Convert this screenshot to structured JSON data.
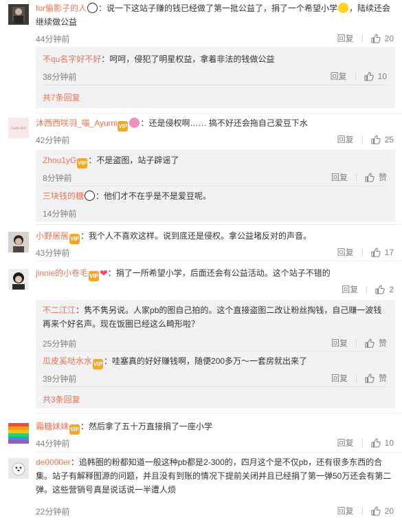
{
  "actions": {
    "reply": "回复",
    "like": "赞"
  },
  "comments": [
    {
      "user": "for偷影子的人",
      "text": "：说一下这站子赚的钱已经做了第一批公益了，捐了一个希望小学",
      "text2": "，陆续还会继续做公益",
      "time": "44分钟前",
      "likes": "20",
      "replies": [
        {
          "user": "不qu名字好不好",
          "text": "：呵呵，侵犯了明星权益，拿着非法的钱做公益",
          "time": "38分钟前",
          "likes": "10"
        }
      ],
      "more": "共7条回复"
    },
    {
      "user": "沐西西咲羽_喵_Ayumi",
      "avatar_text": "Cute Girl",
      "text": "：还是侵权啊…… 搞不好还会拖自己爱豆下水",
      "time": "42分钟前",
      "likes": "25",
      "replies": [
        {
          "user": "Zhou1yG",
          "text": "：不是盗图，站子辟谣了",
          "time": "8分钟前",
          "likes": "赞"
        },
        {
          "user": "三块钱的糖",
          "text": "：他们才不在乎是不是爱豆呢。",
          "time": "14分钟前",
          "likes": "赞"
        }
      ]
    },
    {
      "user": "小野居居",
      "text": "：我个人不喜欢这样。说到底还是侵权。拿公益堵反对的声音。",
      "time": "43分钟前",
      "likes": "17"
    },
    {
      "user": "jinnie的小卷毛",
      "text": "：捐了一所希望小学，后面还会有公益活动。这个站子不错的",
      "time": "",
      "likes": "2",
      "replies": [
        {
          "user": "不二江江",
          "text": "：隽不隽另说。人家pb的图自己拍的。这个直接盗图二改让粉丝掏钱，自己赚一波钱",
          "text2": "再来个好名声。现在饭圈已经这么畸形啦？",
          "time": "25分钟前",
          "likes": "赞"
        },
        {
          "user": "瓜皮奚哒水水",
          "text": "：哇塞真的好好赚钱啊，随便200多万～一套房就出来了",
          "time": "39分钟前",
          "likes": "赞"
        }
      ],
      "more": "共3条回复"
    },
    {
      "user": "霜糖妹妹",
      "text": "：然后拿了五十万直接捐了一座小学",
      "time": "44分钟前",
      "likes": "10"
    },
    {
      "user": "de0000er",
      "text": "：追韩圈的粉都知道一般这种pb都是2-300的，四月这个是不仅pb，还有很多东西的合",
      "text2": "集。站子有解释图源的问题，并且没有到账的情况下提前关闭并且已经捐了第一弹50万还会有第二",
      "text3": "弹。这些营销号真是说话说一半遭人烦",
      "time": "22分钟前",
      "likes": "20"
    }
  ]
}
